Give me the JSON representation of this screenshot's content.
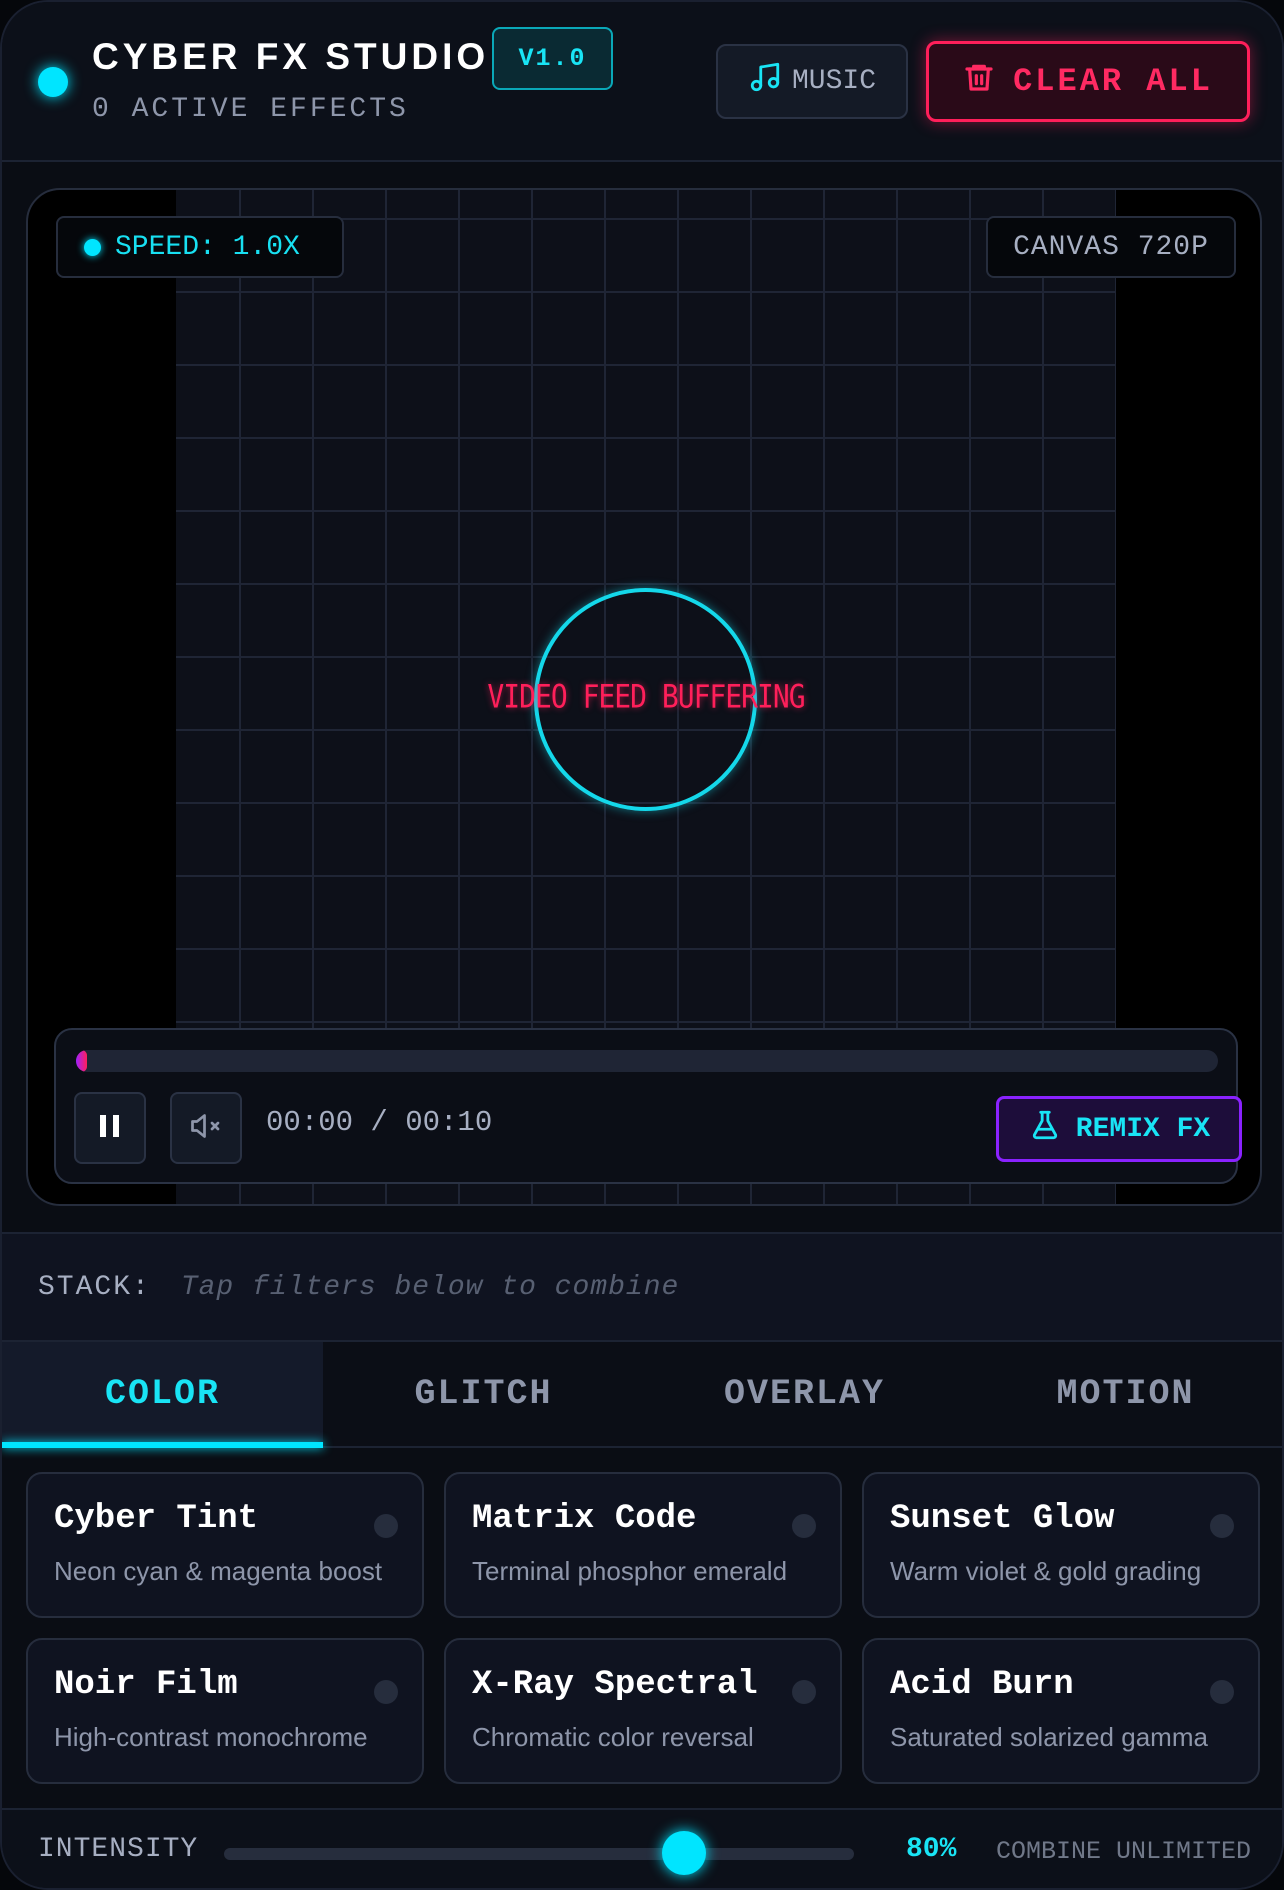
{
  "header": {
    "title": "CYBER FX STUDIO",
    "version": "V1.0",
    "subtitle": "0 ACTIVE EFFECTS",
    "music_label": "MUSIC",
    "clear_label": "CLEAR ALL"
  },
  "stage": {
    "speed": "SPEED: 1.0X",
    "canvas": "CANVAS 720P",
    "buffer_text": "VIDEO FEED BUFFERING",
    "progress_fraction": 0.01,
    "time": "00:00 / 00:10",
    "remix_label": "REMIX FX"
  },
  "stack": {
    "label": "STACK:",
    "hint": "Tap filters below to combine"
  },
  "tabs": [
    {
      "label": "COLOR",
      "active": true
    },
    {
      "label": "GLITCH",
      "active": false
    },
    {
      "label": "OVERLAY",
      "active": false
    },
    {
      "label": "MOTION",
      "active": false
    }
  ],
  "effects": [
    {
      "title": "Cyber Tint",
      "desc": "Neon cyan & magenta boost"
    },
    {
      "title": "Matrix Code",
      "desc": "Terminal phosphor emerald"
    },
    {
      "title": "Sunset Glow",
      "desc": "Warm violet & gold grading"
    },
    {
      "title": "Noir Film",
      "desc": "High-contrast monochrome"
    },
    {
      "title": "X-Ray Spectral",
      "desc": "Chromatic color reversal"
    },
    {
      "title": "Acid Burn",
      "desc": "Saturated solarized gamma"
    }
  ],
  "footer": {
    "intensity_label": "INTENSITY",
    "intensity_value": "80%",
    "intensity_fraction": 0.73,
    "combine_text": "COMBINE UNLIMITED"
  },
  "colors": {
    "accent": "#00e5ff",
    "danger": "#ff1f5a",
    "remix_border": "#8a22ff"
  },
  "icons": {
    "status": "status-dot",
    "music": "music-note-icon",
    "clear": "trash-icon",
    "pause": "pause-icon",
    "mute": "volume-mute-icon",
    "remix": "flask-icon"
  }
}
